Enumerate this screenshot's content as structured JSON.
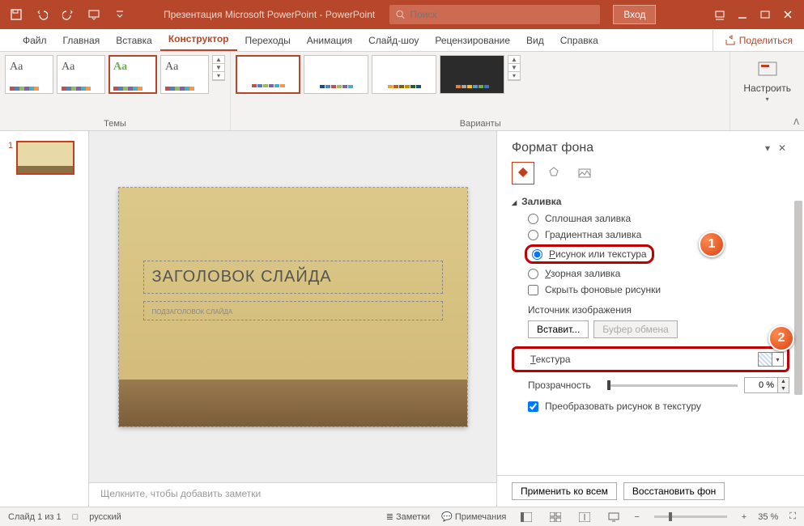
{
  "titlebar": {
    "doc_title": "Презентация Microsoft PowerPoint  -  PowerPoint",
    "search_placeholder": "Поиск",
    "login": "Вход"
  },
  "tabs": {
    "file": "Файл",
    "home": "Главная",
    "insert": "Вставка",
    "design": "Конструктор",
    "transitions": "Переходы",
    "animations": "Анимация",
    "slideshow": "Слайд-шоу",
    "review": "Рецензирование",
    "view": "Вид",
    "help": "Справка",
    "share": "Поделиться"
  },
  "ribbon": {
    "themes_label": "Темы",
    "variants_label": "Варианты",
    "configure": "Настроить",
    "theme_text": "Aa"
  },
  "slide": {
    "number": "1",
    "title": "ЗАГОЛОВОК СЛАЙДА",
    "subtitle": "ПОДЗАГОЛОВОК СЛАЙДА"
  },
  "notes_placeholder": "Щелкните, чтобы добавить заметки",
  "pane": {
    "title": "Формат фона",
    "section_fill": "Заливка",
    "radio_solid": "Сплошная заливка",
    "radio_gradient": "Градиентная заливка",
    "radio_picture_a": "Р",
    "radio_picture_b": "исунок или текстура",
    "radio_pattern_a": "У",
    "radio_pattern_b": "зорная заливка",
    "check_hide": "Скрыть фоновые рисунки",
    "img_source": "Источник изображения",
    "btn_insert": "Вставит...",
    "btn_clipboard": "Буфер обмена",
    "texture_a": "Т",
    "texture_b": "екстура",
    "transparency": "Прозрачность",
    "transparency_val": "0 %",
    "check_tile": "Преобразовать рисунок в текстуру",
    "apply_all": "Применить ко всем",
    "reset": "Восстановить фон"
  },
  "badges": {
    "one": "1",
    "two": "2"
  },
  "status": {
    "slide_of": "Слайд 1 из 1",
    "lang": "русский",
    "notes": "Заметки",
    "comments": "Примечания",
    "zoom": "35 %"
  }
}
